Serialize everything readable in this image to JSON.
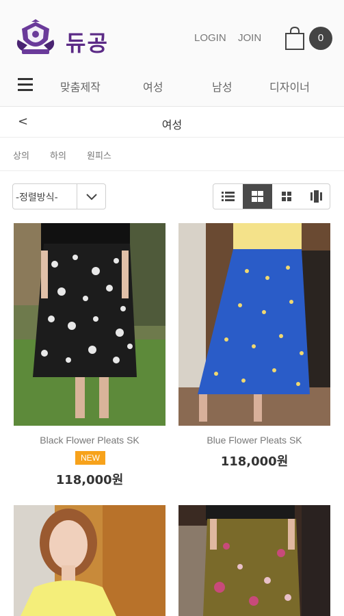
{
  "header": {
    "brand": "듀공",
    "login": "LOGIN",
    "join": "JOIN",
    "cart_count": "0"
  },
  "nav": {
    "items": [
      "맞춤제작",
      "여성",
      "남성",
      "디자이너"
    ]
  },
  "subheader": {
    "back": "<",
    "title": "여성"
  },
  "categories": [
    "상의",
    "하의",
    "원피스"
  ],
  "toolbar": {
    "sort_label": "-정렬방식-",
    "view_modes": [
      "list-view",
      "grid-2-view",
      "grid-3-view",
      "gallery-view"
    ],
    "active_view": "grid-2-view"
  },
  "products": [
    {
      "name": "Black Flower Pleats SK",
      "badge": "NEW",
      "price": "118,000원"
    },
    {
      "name": "Blue Flower Pleats SK",
      "badge": "",
      "price": "118,000원"
    },
    {
      "name": "",
      "badge": "",
      "price": ""
    },
    {
      "name": "",
      "badge": "",
      "price": ""
    }
  ],
  "colors": {
    "brand": "#5b2a86",
    "badge": "#f7a21b",
    "active_view": "#4a4a4a"
  }
}
